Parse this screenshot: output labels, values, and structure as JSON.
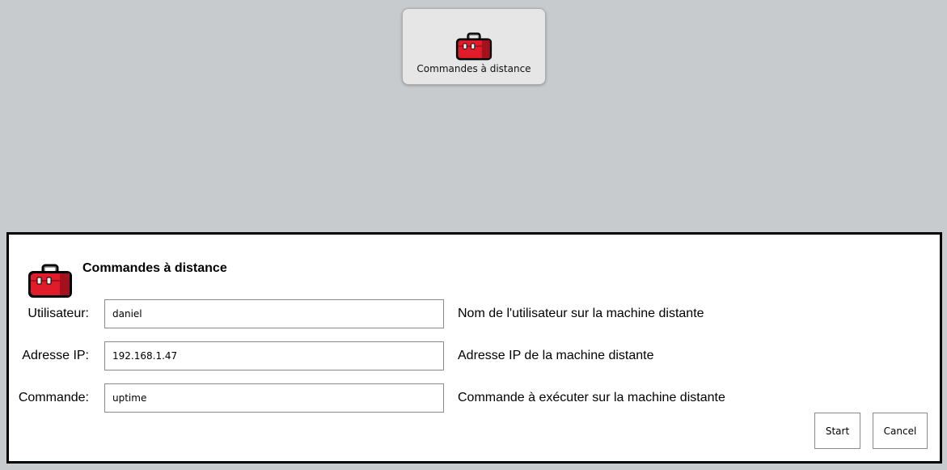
{
  "launcher": {
    "label": "Commandes à distance",
    "icon": "toolbox-icon"
  },
  "dialog": {
    "title": "Commandes à distance",
    "icon": "toolbox-icon",
    "fields": [
      {
        "label": "Utilisateur:",
        "value": "daniel",
        "hint": "Nom de l'utilisateur sur la machine distante"
      },
      {
        "label": "Adresse IP:",
        "value": "192.168.1.47",
        "hint": "Adresse IP de la machine distante"
      },
      {
        "label": "Commande:",
        "value": "uptime",
        "hint": "Commande à exécuter sur la machine distante"
      }
    ],
    "buttons": {
      "start": "Start",
      "cancel": "Cancel"
    }
  },
  "colors": {
    "background": "#c7cbce",
    "toolbox_red": "#e01b2a",
    "toolbox_dark_red": "#a3111c"
  }
}
